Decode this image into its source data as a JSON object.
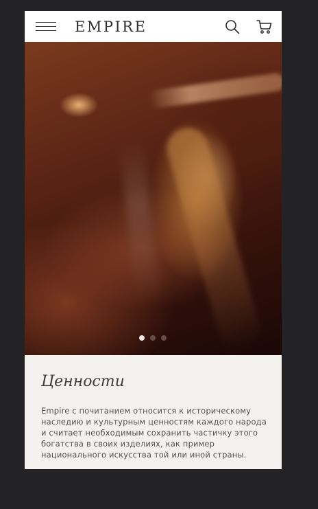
{
  "header": {
    "brand": "EMPIRE",
    "menu_icon": "hamburger-menu-icon",
    "search_icon": "search-icon",
    "cart_icon": "cart-icon"
  },
  "hero": {
    "slide_count": 3,
    "active_slide": 1
  },
  "values_section": {
    "title": "Ценности",
    "text": "Empire с почитанием относится к историческому наследию и культурным ценностям каждого народа и считает необходимым сохранить частичку этого богатства в своих изделиях, как пример национального искусства той или иной страны."
  },
  "colors": {
    "page_background": "#232325",
    "header_background": "#ffffff",
    "content_background": "#f4f2ee",
    "text": "#505050",
    "active_dot": "#efe8e2"
  }
}
